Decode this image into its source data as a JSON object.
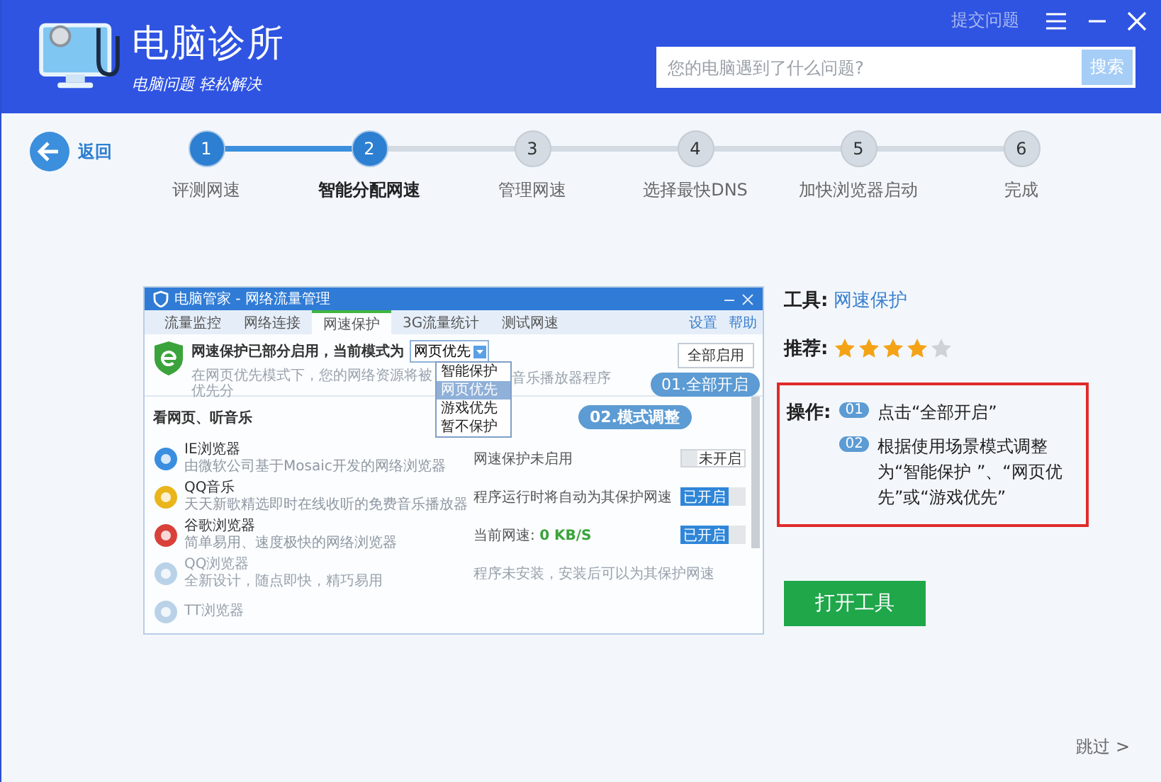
{
  "header": {
    "title": "电脑诊所",
    "subtitle": "电脑问题 轻松解决",
    "submit_link": "提交问题",
    "search": {
      "placeholder": "您的电脑遇到了什么问题?",
      "button": "搜索"
    }
  },
  "back": {
    "label": "返回"
  },
  "steps": [
    {
      "number": "1",
      "label": "评测网速",
      "completed": true,
      "selected": false
    },
    {
      "number": "2",
      "label": "智能分配网速",
      "completed": true,
      "selected": true
    },
    {
      "number": "3",
      "label": "管理网速",
      "completed": false,
      "selected": false
    },
    {
      "number": "4",
      "label": "选择最快DNS",
      "completed": false,
      "selected": false
    },
    {
      "number": "5",
      "label": "加快浏览器启动",
      "completed": false,
      "selected": false
    },
    {
      "number": "6",
      "label": "完成",
      "completed": false,
      "selected": false
    }
  ],
  "app_window": {
    "title": "电脑管家 - 网络流量管理",
    "tabs": [
      {
        "label": "流量监控",
        "selected": false
      },
      {
        "label": "网络连接",
        "selected": false
      },
      {
        "label": "网速保护",
        "selected": true
      },
      {
        "label": "3G流量统计",
        "selected": false
      },
      {
        "label": "测试网速",
        "selected": false
      }
    ],
    "links": [
      "设置",
      "帮助"
    ],
    "status_title": "网速保护已部分启用，当前模式为",
    "mode_value": "网页优先",
    "mode_options": [
      {
        "label": "智能保护",
        "selected": false
      },
      {
        "label": "网页优先",
        "selected": true
      },
      {
        "label": "游戏优先",
        "selected": false
      },
      {
        "label": "暂不保护",
        "selected": false
      }
    ],
    "status_text": "在网页优先模式下，您的网络资源将被优先分",
    "status_text_tail": "音乐播放器程序",
    "enable_all_button": "全部启用",
    "callouts": [
      "01.全部开启",
      "02.模式调整"
    ],
    "section": "看网页、听音乐",
    "apps": [
      {
        "name": "IE浏览器",
        "description": "由微软公司基于Mosaic开发的网络浏览器",
        "status": "网速保护未启用",
        "toggle": "未开启",
        "on": false,
        "installed": true
      },
      {
        "name": "QQ音乐",
        "description": "天天新歌精选即时在线收听的免费音乐播放器",
        "status": "程序运行时将自动为其保护网速",
        "toggle": "已开启",
        "on": true,
        "installed": true
      },
      {
        "name": "谷歌浏览器",
        "description": "简单易用、速度极快的网络浏览器",
        "status": "当前网速: ",
        "speed": "0 KB/S",
        "toggle": "已开启",
        "on": true,
        "installed": true
      },
      {
        "name": "QQ浏览器",
        "description": "全新设计，随点即快，精巧易用",
        "status": "程序未安装，安装后可以为其保护网速",
        "installed": false
      },
      {
        "name": "TT浏览器",
        "installed": false
      }
    ]
  },
  "info": {
    "tool_label": "工具:",
    "tool": "网速保护",
    "rating_label": "推荐:",
    "stars": 4,
    "ops_label": "操作:",
    "ops": [
      {
        "badge": "01",
        "text": "点击“全部开启”"
      },
      {
        "badge": "02",
        "text": "根据使用场景模式调整为“智能保护 ”、“网页优先”或“游戏优先”"
      }
    ],
    "open_button": "打开工具"
  },
  "skip": "跳过 >"
}
